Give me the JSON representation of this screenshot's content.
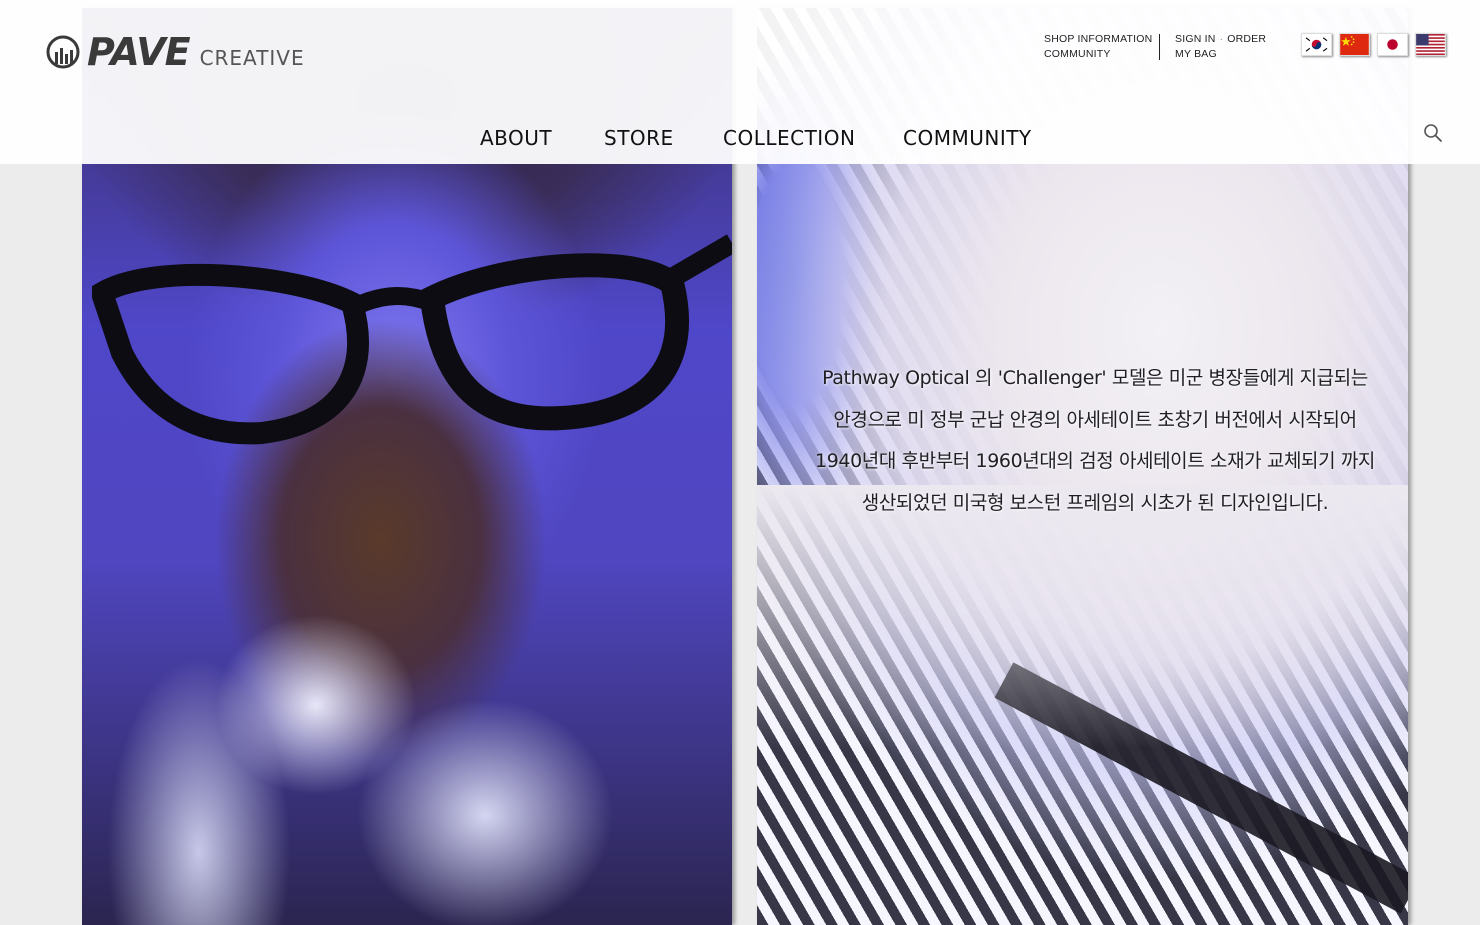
{
  "logo": {
    "word": "PAVE",
    "sub": "CREATIVE"
  },
  "utility": {
    "shop_information": "SHOP INFORMATION",
    "community": "COMMUNITY",
    "sign_in": "SIGN IN",
    "separator": "·",
    "order": "ORDER",
    "my_bag": "MY BAG"
  },
  "flags": [
    "korea-flag",
    "china-flag",
    "japan-flag",
    "usa-flag"
  ],
  "nav": {
    "about": "ABOUT",
    "store": "STORE",
    "collection": "COLLECTION",
    "community": "COMMUNITY"
  },
  "hero": {
    "lines": [
      "Pathway Optical 의 'Challenger' 모델은 미군 병장들에게 지급되는",
      "안경으로 미 정부 군납 안경의 아세테이트 초창기 버전에서 시작되어",
      "1940년대 후반부터 1960년대의 검정 아세테이트 소재가 교체되기 까지",
      "생산되었던 미국형 보스턴 프레임의 시초가 된 디자인입니다."
    ]
  },
  "colors": {
    "background": "#ececec",
    "header_bg": "#ffffff",
    "text": "#222222"
  }
}
